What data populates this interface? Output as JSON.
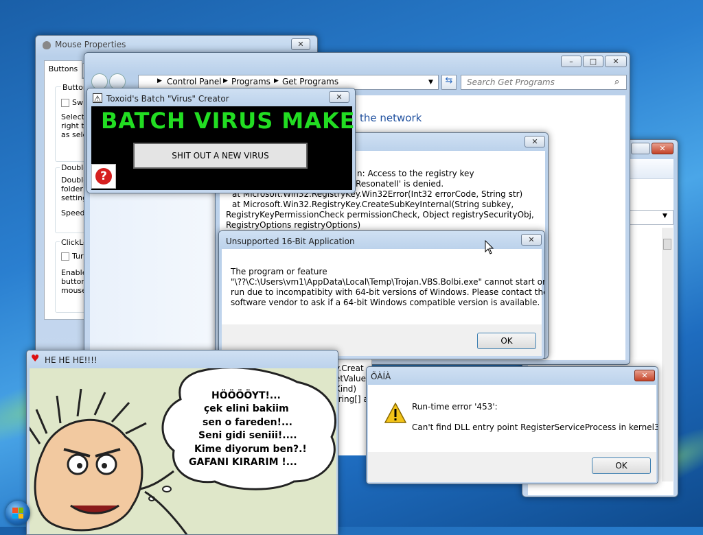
{
  "mouse": {
    "title": "Mouse Properties",
    "tab": "Buttons",
    "group1": "Button",
    "g1_check": "Swi",
    "g1_text1": "Select",
    "g1_text2": "right th",
    "g1_text3": "as sele",
    "group2": "Double",
    "g2_text1": "Double",
    "g2_text2": "folder d",
    "g2_text3": "setting.",
    "speed": "Speed:",
    "group3": "ClickLo",
    "g3_check": "Tur",
    "g3_text1": "Enable",
    "g3_text2": "button.",
    "g3_text3": "mouse"
  },
  "explorer": {
    "crumb1": "Control Panel",
    "crumb2": "Programs",
    "crumb3": "Get Programs",
    "search_placeholder": "Search Get Programs",
    "heading": "the network"
  },
  "batch": {
    "title": "Toxoid's Batch \"Virus\" Creator",
    "heading": "BATCH VIRUS MAKER",
    "button": "SHIT OUT A NEW VIRUS"
  },
  "exception": {
    "line1": "n: Access to the registry key",
    "line2": "ResonateII' is denied.",
    "line3": "at Microsoft.Win32.RegistryKey.Win32Error(Int32 errorCode, String str)",
    "line4": "at Microsoft.Win32.RegistryKey.CreateSubKeyInternal(String subkey,",
    "line5": "RegistryKeyPermissionCheck permissionCheck, Object registrySecurityObj,",
    "line6": "RegistryOptions registryOptions)",
    "bottom1": "y.Creat",
    "bottom2": "etValue",
    "bottom3": "Kind)",
    "bottom4": "tring[] a"
  },
  "unsupported": {
    "title": "Unsupported 16-Bit Application",
    "line1": "The program or feature",
    "line2": "\"\\??\\C:\\Users\\vm1\\AppData\\Local\\Temp\\Trojan.VBS.Bolbi.exe\" cannot start or",
    "line3": "run due to incompatibity with 64-bit versions of Windows. Please contact the",
    "line4": "software vendor to ask if a 64-bit Windows compatible version is available.",
    "ok": "OK"
  },
  "hehe": {
    "title": "HE HE HE!!!!",
    "bubble": [
      "HÖÖÖÖYT!...",
      "çek elini bakiim",
      "sen o fareden!...",
      "Seni gidi seniii!....",
      "Kime diyorum ben?.!",
      "GAFANI KIRARIM !..."
    ]
  },
  "runtime": {
    "title": "ÕÀÍÀ",
    "line1": "Run-time error '453':",
    "line2": "Can't find DLL entry point RegisterServiceProcess in kernel32",
    "ok": "OK"
  },
  "colors": {
    "batch_green": "#22dd22",
    "link_blue": "#1e4f9e"
  }
}
